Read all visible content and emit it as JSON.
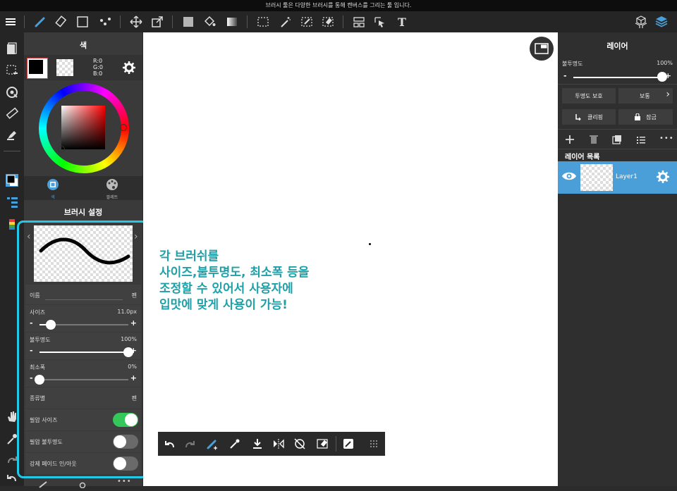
{
  "caption": "브러시 툴은 다양한 브러시를 통해 캔버스를 그리는 툴 입니다.",
  "toolbar": {
    "icons": [
      "menu-icon",
      "brush-icon",
      "eraser-icon",
      "shape-icon",
      "select-dots-icon",
      "move-icon",
      "transform-icon",
      "fill-color-icon",
      "bucket-icon",
      "gradient-icon",
      "selection-icon",
      "magic-wand-icon",
      "select-pen-icon",
      "select-eraser-icon",
      "layout-icon",
      "select-move-icon",
      "text-icon",
      "materials-icon",
      "layers-icon"
    ],
    "text_tool_label": "T"
  },
  "color_panel": {
    "title": "색",
    "rgb": {
      "r": "R:0",
      "g": "G:0",
      "b": "B:0"
    },
    "tab_color": "색",
    "tab_palette": "팔레트"
  },
  "brush_panel": {
    "title": "브러시 설정",
    "name_label": "이름",
    "name_value": "펜",
    "size_label": "사이즈",
    "size_value": "11.0px",
    "size_level": 0.13,
    "opacity_label": "불투명도",
    "opacity_value": "100%",
    "opacity_level": 1.0,
    "min_width_label": "최소폭",
    "min_width_value": "0%",
    "min_width_level": 0.0,
    "type_label": "종류별",
    "type_value": "펜",
    "pressure_size_label": "필압 사이즈",
    "pressure_size_on": true,
    "pressure_opacity_label": "필압 불투명도",
    "pressure_opacity_on": false,
    "fade_label": "강제 페이드 인/아웃",
    "fade_on": false,
    "minus": "-",
    "plus": "+"
  },
  "annotation": [
    "각 브러쉬를",
    "사이즈,불투명도, 최소폭 등을",
    "조정할 수 있어서 사용자에",
    "입맛에 맞게 사용이 가능!"
  ],
  "layer_panel": {
    "title": "레이어",
    "opacity_label": "불투명도",
    "opacity_value": "100%",
    "opacity_level": 1.0,
    "protect_alpha": "투명도 보호",
    "blend_mode": "보통",
    "clipping": "클리핑",
    "lock": "잠금",
    "list_title": "레이어 목록",
    "layer_name": "Layer1",
    "minus": "-",
    "plus": "+"
  },
  "colors": {
    "accent": "#4a9fd8",
    "annotation": "#1fa0a8",
    "highlight_box": "#22c8e6",
    "toggle_on": "#34c759"
  }
}
